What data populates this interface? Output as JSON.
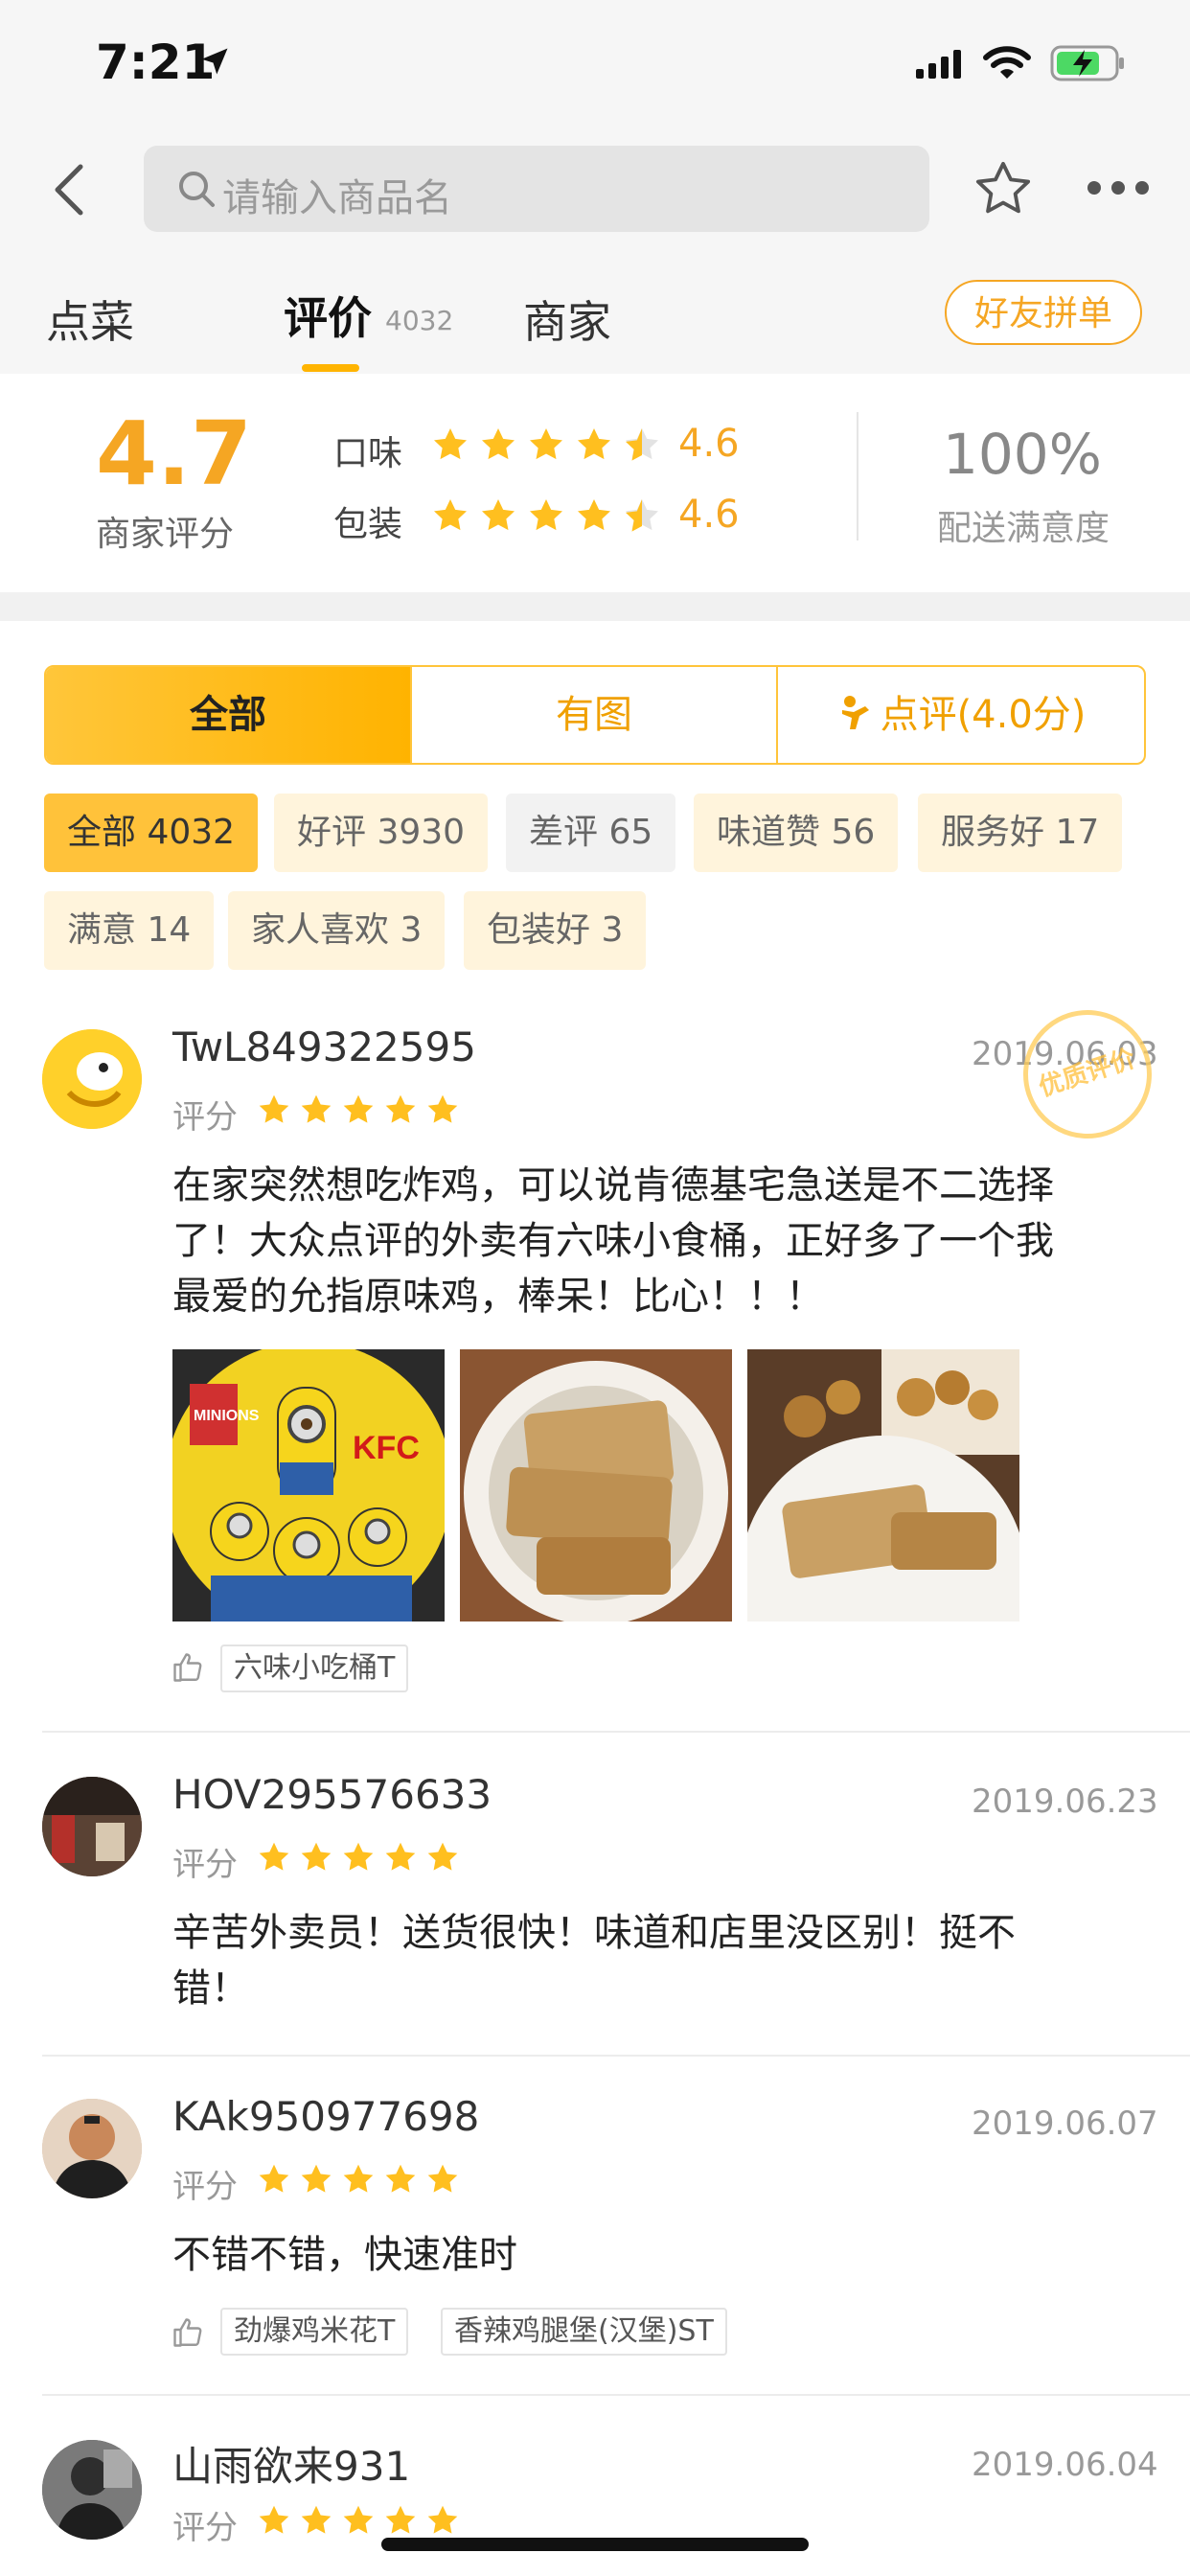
{
  "status_bar": {
    "time": "7:21"
  },
  "nav": {
    "search_placeholder": "请输入商品名"
  },
  "tabs": [
    {
      "label": "点菜"
    },
    {
      "label": "评价",
      "count": "4032"
    },
    {
      "label": "商家"
    }
  ],
  "friends_button": "好友拼单",
  "summary": {
    "score": "4.7",
    "score_label": "商家评分",
    "taste_label": "口味",
    "taste_value": "4.6",
    "package_label": "包装",
    "package_value": "4.6",
    "delivery_pct": "100%",
    "delivery_label": "配送满意度"
  },
  "segments": [
    "全部",
    "有图",
    "点评(4.0分)"
  ],
  "filters": [
    "全部 4032",
    "好评 3930",
    "差评 65",
    "味道赞 56",
    "服务好 17",
    "满意 14",
    "家人喜欢 3",
    "包装好 3"
  ],
  "reviews": [
    {
      "user": "TwL849322595",
      "date": "2019.06.03",
      "rating_label": "评分",
      "badge": "优质评价",
      "lines": [
        "在家突然想吃炸鸡，可以说肯德基宅急送是不二选择",
        "了！大众点评的外卖有六味小食桶，正好多了一个我",
        "最爱的允指原味鸡，棒呆！比心！！！"
      ],
      "photos": [
        "MINIONS",
        "KFC"
      ],
      "tags": [
        "六味小吃桶T"
      ]
    },
    {
      "user": "HOV295576633",
      "date": "2019.06.23",
      "rating_label": "评分",
      "lines": [
        "辛苦外卖员！送货很快！味道和店里没区别！挺不",
        "错！"
      ]
    },
    {
      "user": "KAk950977698",
      "date": "2019.06.07",
      "rating_label": "评分",
      "lines": [
        "不错不错，快速准时"
      ],
      "tags": [
        "劲爆鸡米花T",
        "香辣鸡腿堡(汉堡)ST"
      ]
    },
    {
      "user": "山雨欲来931",
      "date": "2019.06.04",
      "rating_label": "评分"
    }
  ],
  "colors": {
    "accent": "#ffb400",
    "star": "#ffbf1f",
    "orange_text": "#f5a623"
  }
}
